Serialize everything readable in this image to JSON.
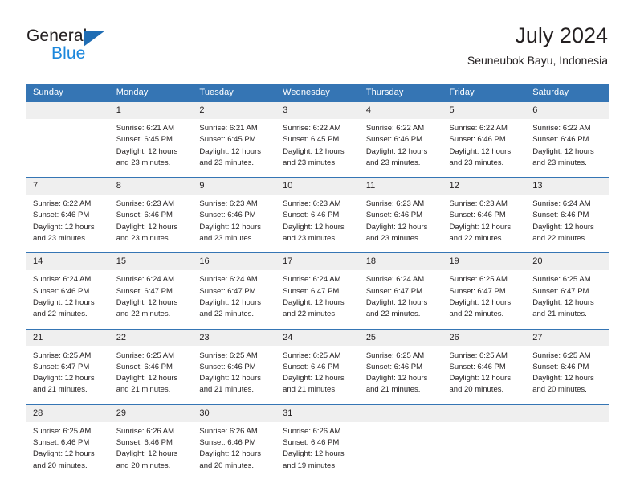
{
  "brand": {
    "name_part1": "General",
    "name_part2": "Blue",
    "accent_color": "#1b87dc",
    "triangle_color": "#1f6db4"
  },
  "header": {
    "title": "July 2024",
    "subtitle": "Seuneubok Bayu, Indonesia"
  },
  "theme": {
    "header_blue": "#3575b4",
    "daynum_band": "#efefef",
    "text": "#231f20"
  },
  "weekdays": [
    "Sunday",
    "Monday",
    "Tuesday",
    "Wednesday",
    "Thursday",
    "Friday",
    "Saturday"
  ],
  "labels": {
    "sunrise_prefix": "Sunrise:",
    "sunset_prefix": "Sunset:",
    "daylight_prefix": "Daylight:"
  },
  "weeks": [
    [
      {
        "day": "",
        "empty": true
      },
      {
        "day": "1",
        "line1": "Sunrise: 6:21 AM",
        "line2": "Sunset: 6:45 PM",
        "line3": "Daylight: 12 hours",
        "line4": "and 23 minutes."
      },
      {
        "day": "2",
        "line1": "Sunrise: 6:21 AM",
        "line2": "Sunset: 6:45 PM",
        "line3": "Daylight: 12 hours",
        "line4": "and 23 minutes."
      },
      {
        "day": "3",
        "line1": "Sunrise: 6:22 AM",
        "line2": "Sunset: 6:45 PM",
        "line3": "Daylight: 12 hours",
        "line4": "and 23 minutes."
      },
      {
        "day": "4",
        "line1": "Sunrise: 6:22 AM",
        "line2": "Sunset: 6:46 PM",
        "line3": "Daylight: 12 hours",
        "line4": "and 23 minutes."
      },
      {
        "day": "5",
        "line1": "Sunrise: 6:22 AM",
        "line2": "Sunset: 6:46 PM",
        "line3": "Daylight: 12 hours",
        "line4": "and 23 minutes."
      },
      {
        "day": "6",
        "line1": "Sunrise: 6:22 AM",
        "line2": "Sunset: 6:46 PM",
        "line3": "Daylight: 12 hours",
        "line4": "and 23 minutes."
      }
    ],
    [
      {
        "day": "7",
        "line1": "Sunrise: 6:22 AM",
        "line2": "Sunset: 6:46 PM",
        "line3": "Daylight: 12 hours",
        "line4": "and 23 minutes."
      },
      {
        "day": "8",
        "line1": "Sunrise: 6:23 AM",
        "line2": "Sunset: 6:46 PM",
        "line3": "Daylight: 12 hours",
        "line4": "and 23 minutes."
      },
      {
        "day": "9",
        "line1": "Sunrise: 6:23 AM",
        "line2": "Sunset: 6:46 PM",
        "line3": "Daylight: 12 hours",
        "line4": "and 23 minutes."
      },
      {
        "day": "10",
        "line1": "Sunrise: 6:23 AM",
        "line2": "Sunset: 6:46 PM",
        "line3": "Daylight: 12 hours",
        "line4": "and 23 minutes."
      },
      {
        "day": "11",
        "line1": "Sunrise: 6:23 AM",
        "line2": "Sunset: 6:46 PM",
        "line3": "Daylight: 12 hours",
        "line4": "and 23 minutes."
      },
      {
        "day": "12",
        "line1": "Sunrise: 6:23 AM",
        "line2": "Sunset: 6:46 PM",
        "line3": "Daylight: 12 hours",
        "line4": "and 22 minutes."
      },
      {
        "day": "13",
        "line1": "Sunrise: 6:24 AM",
        "line2": "Sunset: 6:46 PM",
        "line3": "Daylight: 12 hours",
        "line4": "and 22 minutes."
      }
    ],
    [
      {
        "day": "14",
        "line1": "Sunrise: 6:24 AM",
        "line2": "Sunset: 6:46 PM",
        "line3": "Daylight: 12 hours",
        "line4": "and 22 minutes."
      },
      {
        "day": "15",
        "line1": "Sunrise: 6:24 AM",
        "line2": "Sunset: 6:47 PM",
        "line3": "Daylight: 12 hours",
        "line4": "and 22 minutes."
      },
      {
        "day": "16",
        "line1": "Sunrise: 6:24 AM",
        "line2": "Sunset: 6:47 PM",
        "line3": "Daylight: 12 hours",
        "line4": "and 22 minutes."
      },
      {
        "day": "17",
        "line1": "Sunrise: 6:24 AM",
        "line2": "Sunset: 6:47 PM",
        "line3": "Daylight: 12 hours",
        "line4": "and 22 minutes."
      },
      {
        "day": "18",
        "line1": "Sunrise: 6:24 AM",
        "line2": "Sunset: 6:47 PM",
        "line3": "Daylight: 12 hours",
        "line4": "and 22 minutes."
      },
      {
        "day": "19",
        "line1": "Sunrise: 6:25 AM",
        "line2": "Sunset: 6:47 PM",
        "line3": "Daylight: 12 hours",
        "line4": "and 22 minutes."
      },
      {
        "day": "20",
        "line1": "Sunrise: 6:25 AM",
        "line2": "Sunset: 6:47 PM",
        "line3": "Daylight: 12 hours",
        "line4": "and 21 minutes."
      }
    ],
    [
      {
        "day": "21",
        "line1": "Sunrise: 6:25 AM",
        "line2": "Sunset: 6:47 PM",
        "line3": "Daylight: 12 hours",
        "line4": "and 21 minutes."
      },
      {
        "day": "22",
        "line1": "Sunrise: 6:25 AM",
        "line2": "Sunset: 6:46 PM",
        "line3": "Daylight: 12 hours",
        "line4": "and 21 minutes."
      },
      {
        "day": "23",
        "line1": "Sunrise: 6:25 AM",
        "line2": "Sunset: 6:46 PM",
        "line3": "Daylight: 12 hours",
        "line4": "and 21 minutes."
      },
      {
        "day": "24",
        "line1": "Sunrise: 6:25 AM",
        "line2": "Sunset: 6:46 PM",
        "line3": "Daylight: 12 hours",
        "line4": "and 21 minutes."
      },
      {
        "day": "25",
        "line1": "Sunrise: 6:25 AM",
        "line2": "Sunset: 6:46 PM",
        "line3": "Daylight: 12 hours",
        "line4": "and 21 minutes."
      },
      {
        "day": "26",
        "line1": "Sunrise: 6:25 AM",
        "line2": "Sunset: 6:46 PM",
        "line3": "Daylight: 12 hours",
        "line4": "and 20 minutes."
      },
      {
        "day": "27",
        "line1": "Sunrise: 6:25 AM",
        "line2": "Sunset: 6:46 PM",
        "line3": "Daylight: 12 hours",
        "line4": "and 20 minutes."
      }
    ],
    [
      {
        "day": "28",
        "line1": "Sunrise: 6:25 AM",
        "line2": "Sunset: 6:46 PM",
        "line3": "Daylight: 12 hours",
        "line4": "and 20 minutes."
      },
      {
        "day": "29",
        "line1": "Sunrise: 6:26 AM",
        "line2": "Sunset: 6:46 PM",
        "line3": "Daylight: 12 hours",
        "line4": "and 20 minutes."
      },
      {
        "day": "30",
        "line1": "Sunrise: 6:26 AM",
        "line2": "Sunset: 6:46 PM",
        "line3": "Daylight: 12 hours",
        "line4": "and 20 minutes."
      },
      {
        "day": "31",
        "line1": "Sunrise: 6:26 AM",
        "line2": "Sunset: 6:46 PM",
        "line3": "Daylight: 12 hours",
        "line4": "and 19 minutes."
      },
      {
        "day": "",
        "empty": true
      },
      {
        "day": "",
        "empty": true
      },
      {
        "day": "",
        "empty": true
      }
    ]
  ]
}
